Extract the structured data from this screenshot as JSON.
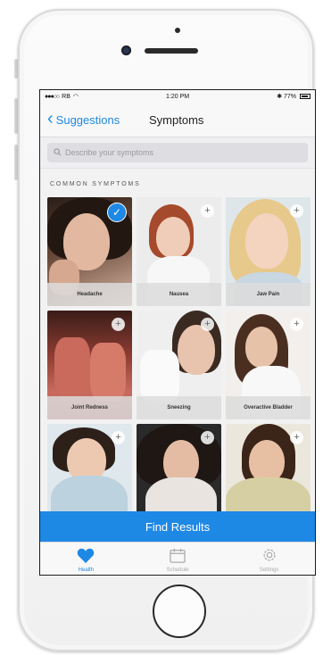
{
  "statusbar": {
    "carrier": "RB",
    "time": "1:20 PM",
    "battery": "77%"
  },
  "nav": {
    "back_label": "Suggestions",
    "title": "Symptoms"
  },
  "search": {
    "placeholder": "Describe your symptoms"
  },
  "section": {
    "title": "COMMON SYMPTOMS"
  },
  "symptoms": [
    {
      "label": "Headache",
      "selected": true
    },
    {
      "label": "Nausea",
      "selected": false
    },
    {
      "label": "Jaw Pain",
      "selected": false
    },
    {
      "label": "Joint Redness",
      "selected": false
    },
    {
      "label": "Sneezing",
      "selected": false
    },
    {
      "label": "Overactive Bladder",
      "selected": false
    },
    {
      "label": "",
      "selected": false
    },
    {
      "label": "",
      "selected": false
    },
    {
      "label": "",
      "selected": false
    }
  ],
  "find_button": {
    "label": "Find Results"
  },
  "tabs": [
    {
      "label": "Health",
      "icon": "heart-icon",
      "active": true
    },
    {
      "label": "Schedule",
      "icon": "calendar-icon",
      "active": false
    },
    {
      "label": "Settings",
      "icon": "gear-icon",
      "active": false
    }
  ],
  "colors": {
    "accent": "#1e88e5"
  }
}
